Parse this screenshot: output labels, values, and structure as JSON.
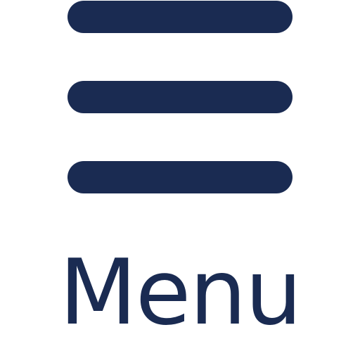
{
  "menu": {
    "label": "Menu",
    "icon": "hamburger-menu-icon",
    "color": "#1a2b52"
  }
}
